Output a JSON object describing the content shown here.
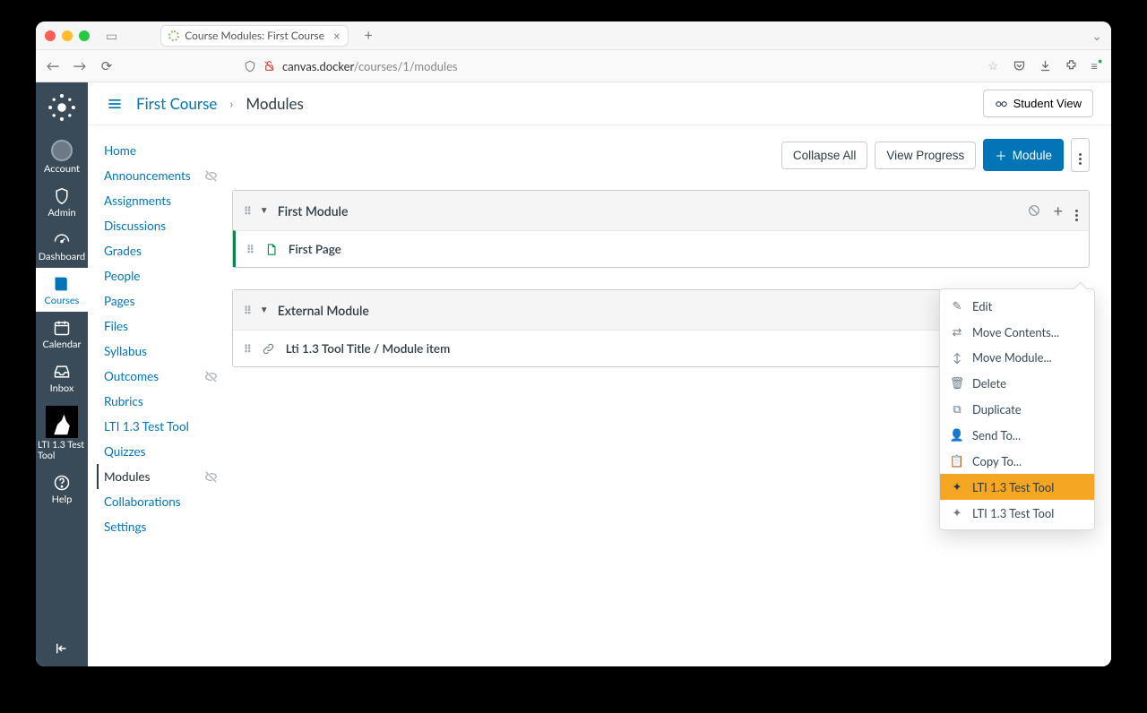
{
  "browser": {
    "tab_title": "Course Modules: First Course",
    "url_host": "canvas.docker",
    "url_path": "/courses/1/modules"
  },
  "globalNav": {
    "account": "Account",
    "admin": "Admin",
    "dashboard": "Dashboard",
    "courses": "Courses",
    "calendar": "Calendar",
    "inbox": "Inbox",
    "lti_tool": "LTI 1.3 Test Tool",
    "help": "Help"
  },
  "breadcrumb": {
    "course": "First Course",
    "current": "Modules"
  },
  "buttons": {
    "student_view": "Student View",
    "collapse_all": "Collapse All",
    "view_progress": "View Progress",
    "add_module": "Module"
  },
  "courseNav": [
    {
      "label": "Home",
      "hidden": false,
      "active": false
    },
    {
      "label": "Announcements",
      "hidden": true,
      "active": false
    },
    {
      "label": "Assignments",
      "hidden": false,
      "active": false
    },
    {
      "label": "Discussions",
      "hidden": false,
      "active": false
    },
    {
      "label": "Grades",
      "hidden": false,
      "active": false
    },
    {
      "label": "People",
      "hidden": false,
      "active": false
    },
    {
      "label": "Pages",
      "hidden": false,
      "active": false
    },
    {
      "label": "Files",
      "hidden": false,
      "active": false
    },
    {
      "label": "Syllabus",
      "hidden": false,
      "active": false
    },
    {
      "label": "Outcomes",
      "hidden": true,
      "active": false
    },
    {
      "label": "Rubrics",
      "hidden": false,
      "active": false
    },
    {
      "label": "LTI 1.3 Test Tool",
      "hidden": false,
      "active": false
    },
    {
      "label": "Quizzes",
      "hidden": false,
      "active": false
    },
    {
      "label": "Modules",
      "hidden": true,
      "active": true
    },
    {
      "label": "Collaborations",
      "hidden": false,
      "active": false
    },
    {
      "label": "Settings",
      "hidden": false,
      "active": false
    }
  ],
  "modules": [
    {
      "title": "First Module",
      "items": [
        {
          "type": "page",
          "title": "First Page",
          "published": true
        }
      ]
    },
    {
      "title": "External Module",
      "items": [
        {
          "type": "link",
          "title": "Lti 1.3 Tool Title / Module item",
          "published": false
        }
      ]
    }
  ],
  "menu": {
    "edit": "Edit",
    "move_contents": "Move Contents...",
    "move_module": "Move Module...",
    "delete": "Delete",
    "duplicate": "Duplicate",
    "send_to": "Send To...",
    "copy_to": "Copy To...",
    "lti1": "LTI 1.3 Test Tool",
    "lti2": "LTI 1.3 Test Tool"
  }
}
